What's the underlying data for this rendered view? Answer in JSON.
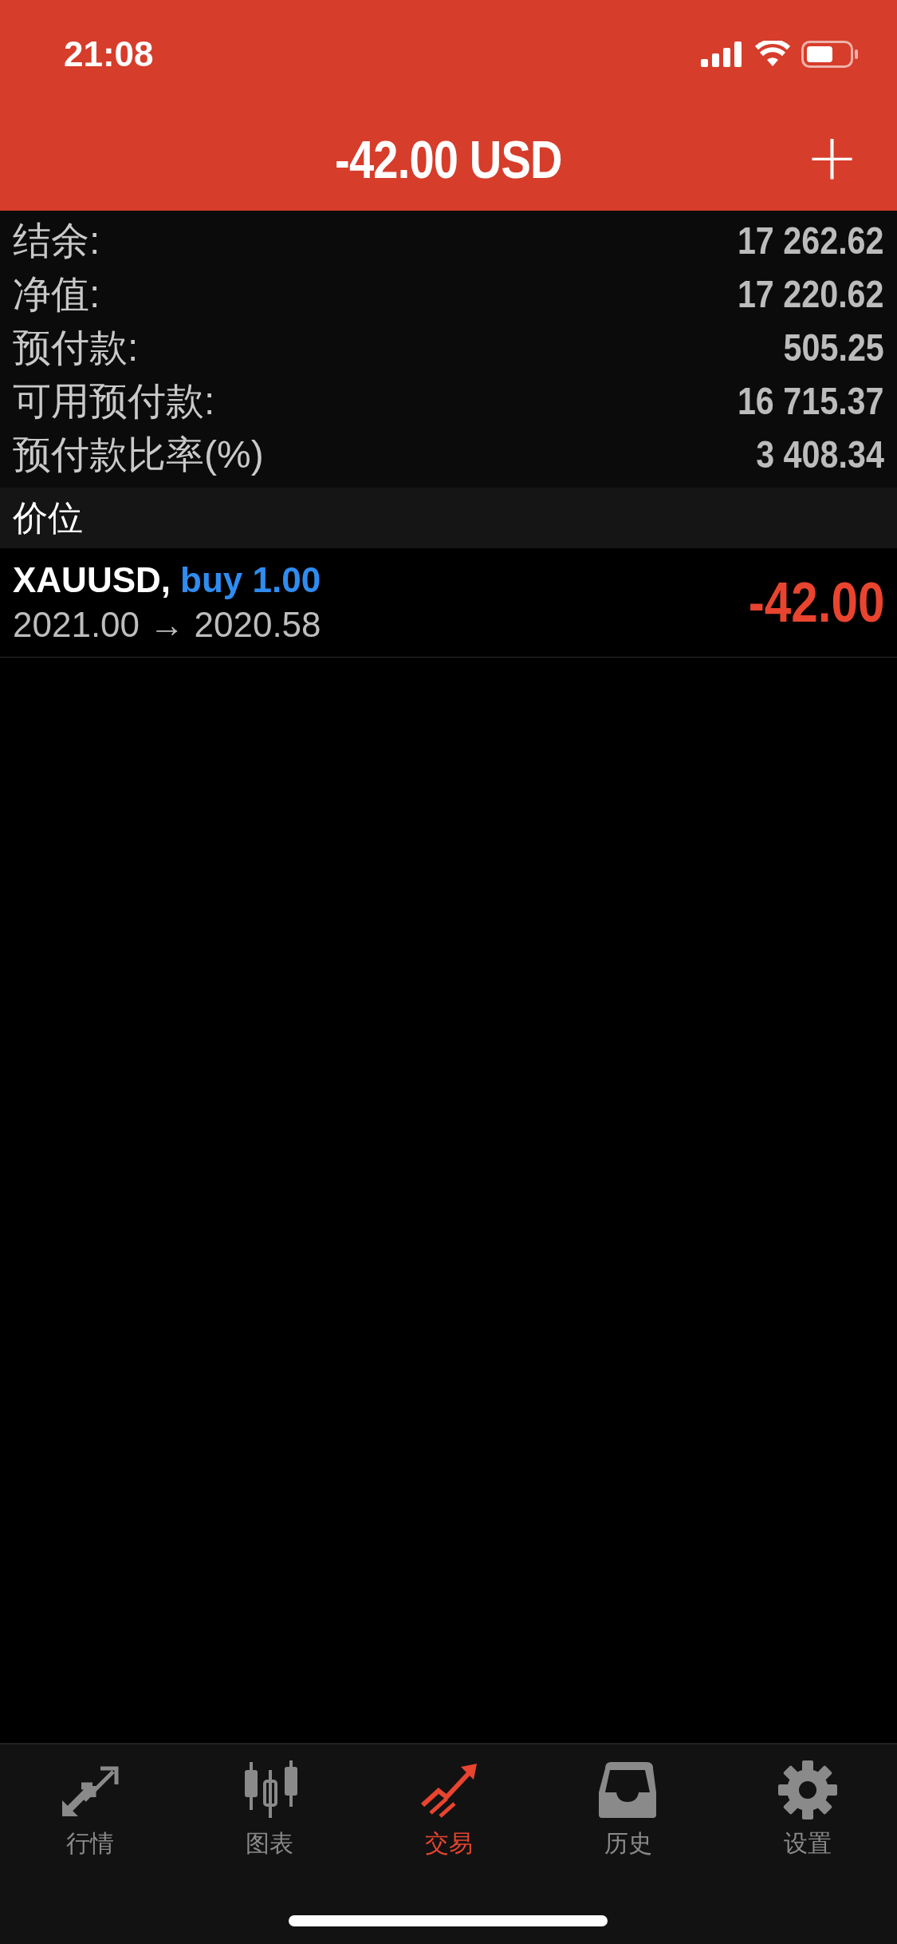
{
  "status_bar": {
    "time": "21:08"
  },
  "header": {
    "title": "-42.00 USD",
    "action": "+"
  },
  "summary": [
    {
      "label": "结余:",
      "value": "17 262.62"
    },
    {
      "label": "净值:",
      "value": "17 220.62"
    },
    {
      "label": "预付款:",
      "value": "505.25"
    },
    {
      "label": "可用预付款:",
      "value": "16 715.37"
    },
    {
      "label": "预付款比率(%)",
      "value": "3 408.34"
    }
  ],
  "positions_section": {
    "title": "价位"
  },
  "positions": [
    {
      "symbol": "XAUUSD,",
      "order": "buy 1.00",
      "prices": "2021.00 → 2020.58",
      "profit": "-42.00"
    }
  ],
  "tabs": [
    {
      "label": "行情",
      "kind": "quotes",
      "selected": false
    },
    {
      "label": "图表",
      "kind": "chart",
      "selected": false
    },
    {
      "label": "交易",
      "kind": "trade",
      "selected": true
    },
    {
      "label": "历史",
      "kind": "history",
      "selected": false
    },
    {
      "label": "设置",
      "kind": "settings",
      "selected": false
    }
  ]
}
